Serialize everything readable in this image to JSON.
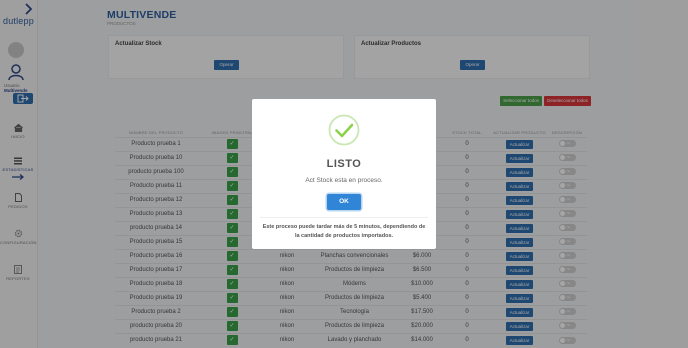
{
  "sidebar": {
    "brand": "dutlepp",
    "user_label": "Usuario",
    "user_name": "Multivende",
    "nav": [
      {
        "label": "INICIO",
        "icon": "home-icon"
      },
      {
        "label": "ESTADISTICAS",
        "icon": "list-icon"
      },
      {
        "label": "PEDIDOS",
        "icon": "document-icon"
      },
      {
        "label": "CONFIGURACIÓN",
        "icon": "gear-icon"
      },
      {
        "label": "REPORTES",
        "icon": "report-icon"
      }
    ]
  },
  "header": {
    "title": "MULTIVENDE",
    "subtitle": "PRODUCTOS"
  },
  "cards": [
    {
      "title": "Actualizar Stock",
      "button": "Operar"
    },
    {
      "title": "Actualizar Productos",
      "button": "Operar"
    }
  ],
  "bulk": {
    "select_all": "Seleccionar todos",
    "deselect_all": "Deseleccionar todos"
  },
  "table": {
    "headers": [
      "NOMBRE DEL PRODUCTO",
      "IMAGEN PRINCIPAL",
      "",
      "",
      "",
      "STOCK TOTAL",
      "ACTUALIZAR PRODUCTO",
      "DESCRIPCIÓN"
    ],
    "action_label": "Actualizar",
    "toggle_label": "No",
    "rows": [
      {
        "name": "Producto prueba 1",
        "brand": "",
        "category": "",
        "price": "",
        "stock": "0"
      },
      {
        "name": "Producto prueba 10",
        "brand": "",
        "category": "",
        "price": "",
        "stock": "0"
      },
      {
        "name": "producto prueba 100",
        "brand": "",
        "category": "",
        "price": "",
        "stock": "0"
      },
      {
        "name": "Producto prueba 11",
        "brand": "",
        "category": "",
        "price": "",
        "stock": "0"
      },
      {
        "name": "Producto prueba 12",
        "brand": "",
        "category": "",
        "price": "",
        "stock": "0"
      },
      {
        "name": "Producto prueba 13",
        "brand": "",
        "category": "",
        "price": "",
        "stock": "0"
      },
      {
        "name": "producto prueba 14",
        "brand": "",
        "category": "",
        "price": "",
        "stock": "0"
      },
      {
        "name": "Producto prueba 15",
        "brand": "",
        "category": "",
        "price": "",
        "stock": "0"
      },
      {
        "name": "Producto prueba 16",
        "brand": "nikon",
        "category": "Planchas convencionales",
        "price": "$6.000",
        "stock": "0"
      },
      {
        "name": "Producto prueba 17",
        "brand": "nikon",
        "category": "Productos de limpieza",
        "price": "$6.500",
        "stock": "0"
      },
      {
        "name": "Producto prueba 18",
        "brand": "nikon",
        "category": "Módems",
        "price": "$10.000",
        "stock": "0"
      },
      {
        "name": "Producto prueba 19",
        "brand": "nikon",
        "category": "Productos de limpieza",
        "price": "$5.400",
        "stock": "0"
      },
      {
        "name": "Producto prueba 2",
        "brand": "nikon",
        "category": "Tecnología",
        "price": "$17.500",
        "stock": "0"
      },
      {
        "name": "producto prueba 20",
        "brand": "nikon",
        "category": "Productos de limpieza",
        "price": "$20.000",
        "stock": "0"
      },
      {
        "name": "producto prueba 21",
        "brand": "nikon",
        "category": "Lavado y planchado",
        "price": "$14.000",
        "stock": "0"
      }
    ]
  },
  "modal": {
    "icon": "success-check-icon",
    "title": "LISTO",
    "text": "Act Stock esta en proceso.",
    "ok_label": "OK",
    "footer": "Este proceso puede tardar más de 5 minutos, dependiendo de la cantidad de productos importados."
  },
  "colors": {
    "brand": "#2f5f9e",
    "primary": "#2f6fb0",
    "success": "#3aa24a",
    "danger": "#d9353c",
    "ok_button": "#3085d6"
  }
}
